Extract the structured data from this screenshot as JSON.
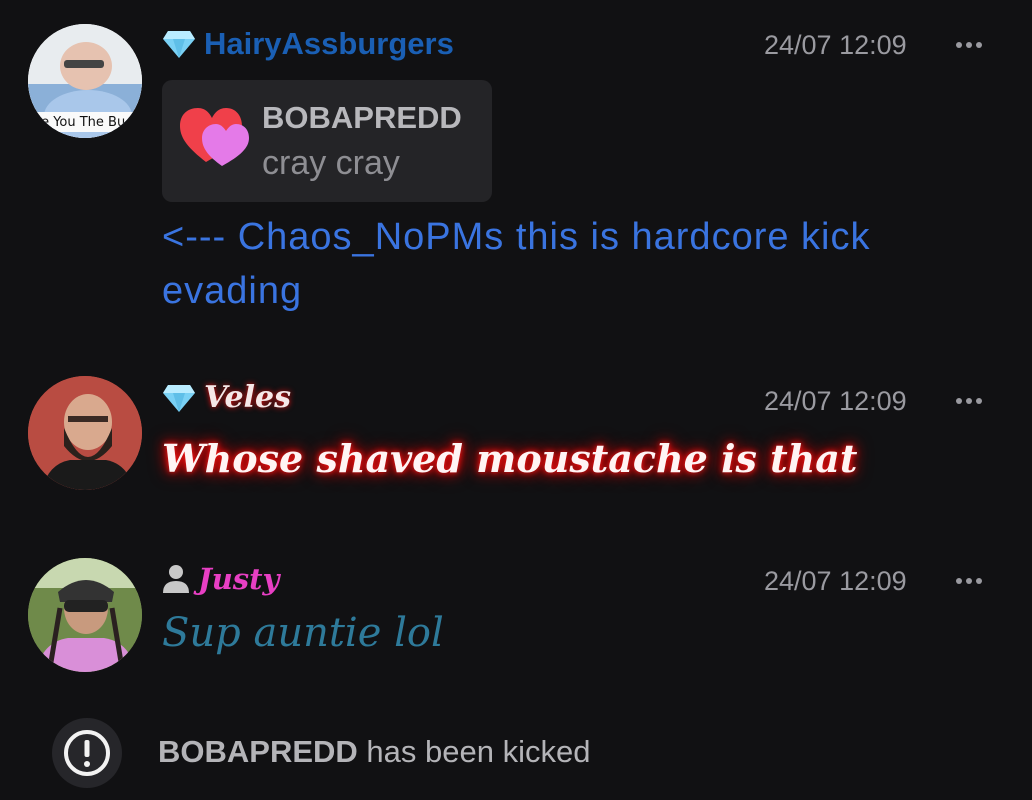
{
  "messages": [
    {
      "username": "HairyAssburgers",
      "badge": "diamond-icon",
      "time": "24/07 12:09",
      "avatar_caption": "ke You The Bu",
      "reply": {
        "author": "BOBAPREDD",
        "text": "cray cray",
        "icon": "heart-icon"
      },
      "text": "<--- Chaos_NoPMs this is hardcore kick evading",
      "colors": {
        "username": "#1a5fb4",
        "text": "#3a74e0"
      }
    },
    {
      "username": "Veles",
      "badge": "diamond-icon",
      "time": "24/07 12:09",
      "text": "Whose shaved moustache is that",
      "colors": {
        "username": "#f5e8e8",
        "glow": "#ff1a1a"
      }
    },
    {
      "username": "Justy",
      "badge": "user-icon",
      "time": "24/07 12:09",
      "text": "Sup auntie lol",
      "colors": {
        "username": "#e83fc4",
        "text": "#2e7a9a"
      }
    }
  ],
  "system": {
    "icon": "alert-icon",
    "user": "BOBAPREDD",
    "text": "has been kicked"
  }
}
